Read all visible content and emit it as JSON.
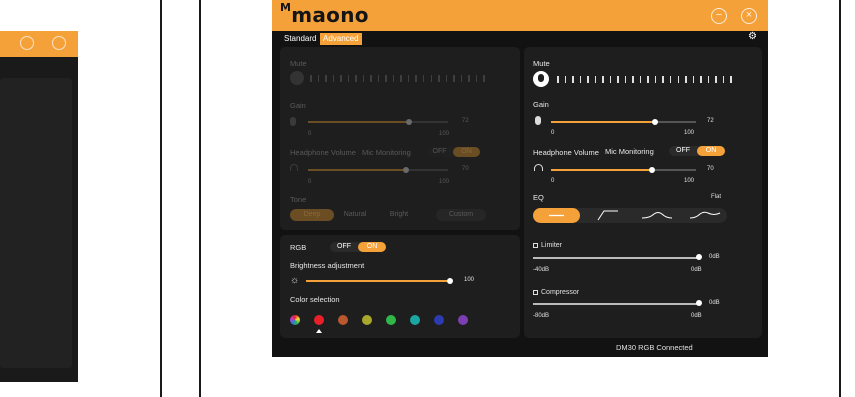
{
  "app": {
    "logo_text": "maono",
    "logo_mark": "M",
    "minimize_icon": "minus-circle-icon",
    "close_icon": "x-circle-icon",
    "accent": "#f5a13a"
  },
  "tabs": [
    {
      "label": "Standard",
      "active": false
    },
    {
      "label": "Advanced",
      "active": true
    }
  ],
  "left_panel": {
    "mute_label": "Mute",
    "gain": {
      "label": "Gain",
      "value": "72",
      "min": "0",
      "max": "100",
      "fraction": 0.72
    },
    "headphone": {
      "label": "Headphone Volume",
      "monitor_label": "Mic Monitoring",
      "off": "OFF",
      "on": "ON",
      "value": "70",
      "min": "0",
      "max": "100",
      "fraction": 0.7
    },
    "tone": {
      "label": "Tone",
      "options": [
        "Deep",
        "Natural",
        "Bright",
        "Custom"
      ],
      "selected": 0
    }
  },
  "rgb_panel": {
    "rgb_label": "RGB",
    "off": "OFF",
    "on": "ON",
    "brightness_label": "Brightness adjustment",
    "brightness_value": "100",
    "brightness_fraction": 1.0,
    "color_label": "Color selection",
    "colors": [
      "#c23bc4",
      "#e8202a",
      "#b9572e",
      "#a9a82c",
      "#31b649",
      "#1aa7a3",
      "#2d3bb0",
      "#7b3fb1"
    ],
    "selected_color": 1
  },
  "right_panel": {
    "mute_label": "Mute",
    "gain": {
      "label": "Gain",
      "value": "72",
      "min": "0",
      "max": "100",
      "fraction": 0.72
    },
    "headphone": {
      "label": "Headphone Volume",
      "monitor_label": "Mic Monitoring",
      "off": "OFF",
      "on": "ON",
      "value": "70",
      "min": "0",
      "max": "100",
      "fraction": 0.7
    },
    "eq": {
      "label": "EQ",
      "current": "Flat",
      "selected": 0
    },
    "limiter": {
      "label": "Limiter",
      "value": "0dB",
      "min": "-40dB",
      "max": "0dB",
      "fraction": 1.0
    },
    "compressor": {
      "label": "Compressor",
      "value": "0dB",
      "min": "-80dB",
      "max": "0dB",
      "fraction": 1.0
    }
  },
  "status": {
    "text": "DM30 RGB Connected"
  }
}
